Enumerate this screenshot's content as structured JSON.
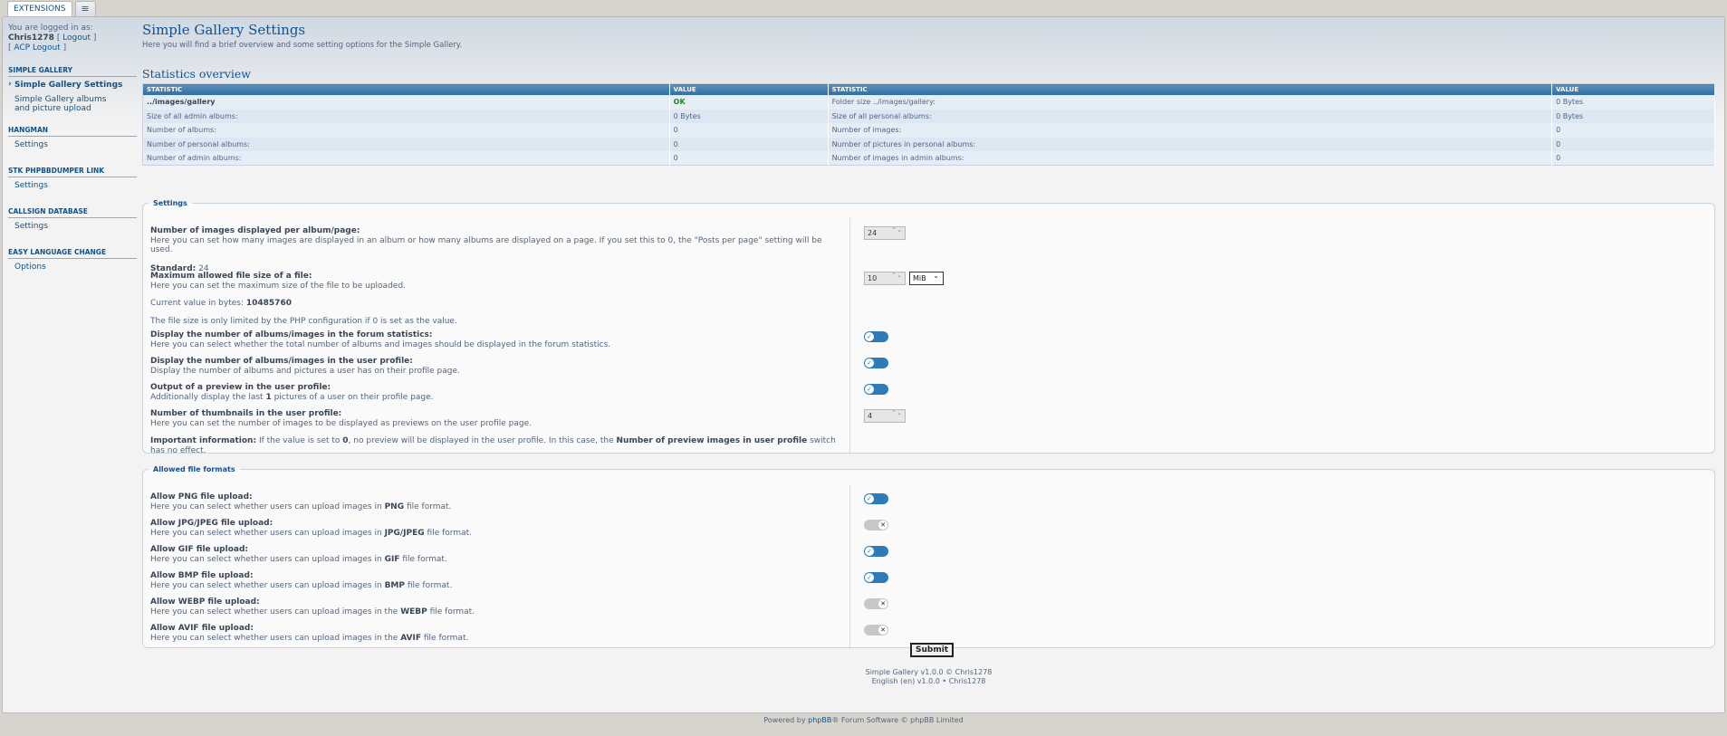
{
  "tabs": {
    "extensions": "EXTENSIONS",
    "menu_icon": "≡"
  },
  "sidebar": {
    "logged_in_as": "You are logged in as:",
    "username": "Chris1278",
    "logout": "Logout",
    "acp_logout": "ACP Logout",
    "sections": [
      {
        "title": "SIMPLE GALLERY",
        "items": [
          "Simple Gallery Settings",
          "Simple Gallery albums and picture upload"
        ]
      },
      {
        "title": "HANGMAN",
        "items": [
          "Settings"
        ]
      },
      {
        "title": "STK PHPBBDUMPER LINK",
        "items": [
          "Settings"
        ]
      },
      {
        "title": "CALLSIGN DATABASE",
        "items": [
          "Settings"
        ]
      },
      {
        "title": "EASY LANGUAGE CHANGE",
        "items": [
          "Options"
        ]
      }
    ]
  },
  "main": {
    "title": "Simple Gallery Settings",
    "intro": "Here you will find a brief overview and some setting options for the Simple Gallery.",
    "stats_title": "Statistics overview",
    "stats_headers": [
      "STATISTIC",
      "VALUE",
      "STATISTIC",
      "VALUE"
    ],
    "stats_rows": [
      [
        "../images/gallery",
        "OK",
        "Folder size ../images/gallery:",
        "0 Bytes"
      ],
      [
        "Size of all admin albums:",
        "0 Bytes",
        "Size of all personal albums:",
        "0 Bytes"
      ],
      [
        "Number of albums:",
        "0",
        "Number of images:",
        "0"
      ],
      [
        "Number of personal albums:",
        "0",
        "Number of pictures in personal albums:",
        "0"
      ],
      [
        "Number of admin albums:",
        "0",
        "Number of images in admin albums:",
        "0"
      ]
    ]
  },
  "settings": {
    "legend": "Settings",
    "images_per_page": {
      "label": "Number of images displayed per album/page:",
      "desc": "Here you can set how many images are displayed in an album or how many albums are displayed on a page. If you set this to 0, the \"Posts per page\" setting will be used.",
      "standard_label": "Standard:",
      "standard_value": "24",
      "value": "24"
    },
    "max_file_size": {
      "label": "Maximum allowed file size of a file:",
      "desc": "Here you can set the maximum size of the file to be uploaded.",
      "bytes_label": "Current value in bytes:",
      "bytes_value": "10485760",
      "note": "The file size is only limited by the PHP configuration if 0 is set as the value.",
      "value": "10",
      "unit": "MiB"
    },
    "forum_stats": {
      "label": "Display the number of albums/images in the forum statistics:",
      "desc": "Here you can select whether the total number of albums and images should be displayed in the forum statistics.",
      "on": true
    },
    "user_profile": {
      "label": "Display the number of albums/images in the user profile:",
      "desc": "Display the number of albums and pictures a user has on their profile page.",
      "on": true
    },
    "preview": {
      "label": "Output of a preview in the user profile:",
      "desc_a": "Additionally display the last",
      "desc_b": "1",
      "desc_c": "pictures of a user on their profile page.",
      "on": true
    },
    "thumbnails": {
      "label": "Number of thumbnails in the user profile:",
      "desc": "Here you can set the number of images to be displayed as previews on the user profile page.",
      "value": "4",
      "info_label": "Important information:",
      "info_a": "If the value is set to",
      "info_b": "0",
      "info_c": ", no preview will be displayed in the user profile. In this case, the",
      "info_d": "Number of preview images in user profile",
      "info_e": "switch has no effect."
    }
  },
  "formats": {
    "legend": "Allowed file formats",
    "desc_prefix": "Here you can select whether users can upload images in",
    "desc_prefix_the": "Here you can select whether users can upload images in the",
    "desc_suffix": "file format.",
    "items": [
      {
        "label": "Allow PNG file upload:",
        "fmt": "PNG",
        "on": true
      },
      {
        "label": "Allow JPG/JPEG file upload:",
        "fmt": "JPG/JPEG",
        "on": false
      },
      {
        "label": "Allow GIF file upload:",
        "fmt": "GIF",
        "on": true
      },
      {
        "label": "Allow BMP file upload:",
        "fmt": "BMP",
        "on": true
      },
      {
        "label": "Allow WEBP file upload:",
        "fmt": "WEBP",
        "on": false
      },
      {
        "label": "Allow AVIF file upload:",
        "fmt": "AVIF",
        "on": false
      }
    ]
  },
  "submit_label": "Submit",
  "footer": {
    "line1": "Simple Gallery v1.0.0 © Chris1278",
    "line2": "English (en) v1.0.0 • Chris1278",
    "powered_a": "Powered by",
    "powered_link": "phpBB",
    "powered_b": "® Forum Software © phpBB Limited"
  }
}
